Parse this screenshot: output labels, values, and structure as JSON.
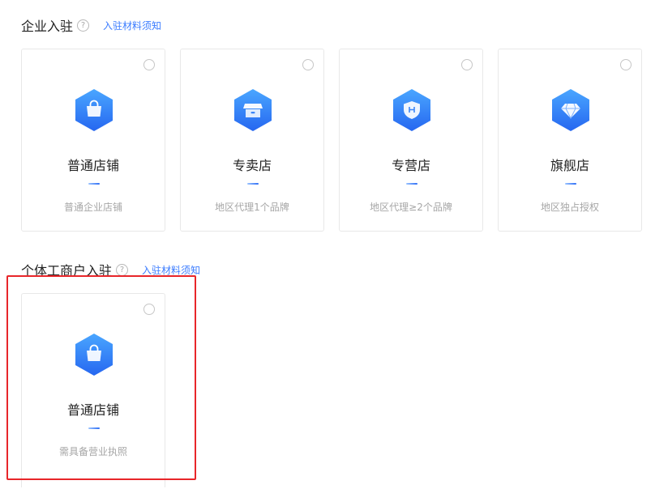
{
  "enterprise": {
    "title": "企业入驻",
    "help_glyph": "?",
    "notice_link": "入驻材料须知",
    "cards": [
      {
        "title": "普通店铺",
        "desc": "普通企业店铺",
        "icon": "shopping-bag-icon"
      },
      {
        "title": "专卖店",
        "desc": "地区代理1个品牌",
        "icon": "storefront-icon"
      },
      {
        "title": "专营店",
        "desc": "地区代理≥2个品牌",
        "icon": "shield-icon"
      },
      {
        "title": "旗舰店",
        "desc": "地区独占授权",
        "icon": "diamond-icon"
      }
    ]
  },
  "individual": {
    "title": "个体工商户入驻",
    "help_glyph": "?",
    "notice_link": "入驻材料须知",
    "cards": [
      {
        "title": "普通店铺",
        "desc": "需具备营业执照",
        "icon": "shopping-bag-icon"
      }
    ]
  },
  "colors": {
    "accent": "#3b7cff",
    "icon_gradient_top": "#4aa6ff",
    "icon_gradient_bottom": "#2667f0",
    "highlight_border": "#e8262a"
  }
}
